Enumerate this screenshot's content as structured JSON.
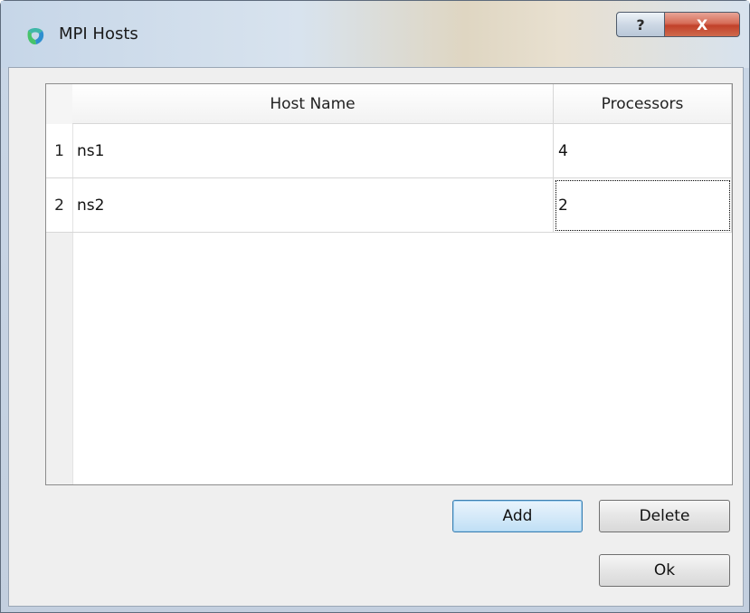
{
  "window": {
    "title": "MPI Hosts",
    "help_label": "?",
    "close_label": "X"
  },
  "table": {
    "columns": [
      "Host Name",
      "Processors"
    ],
    "rows": [
      {
        "index": "1",
        "host": "ns1",
        "processors": "4"
      },
      {
        "index": "2",
        "host": "ns2",
        "processors": "2"
      }
    ]
  },
  "buttons": {
    "add": "Add",
    "delete": "Delete",
    "ok": "Ok"
  }
}
